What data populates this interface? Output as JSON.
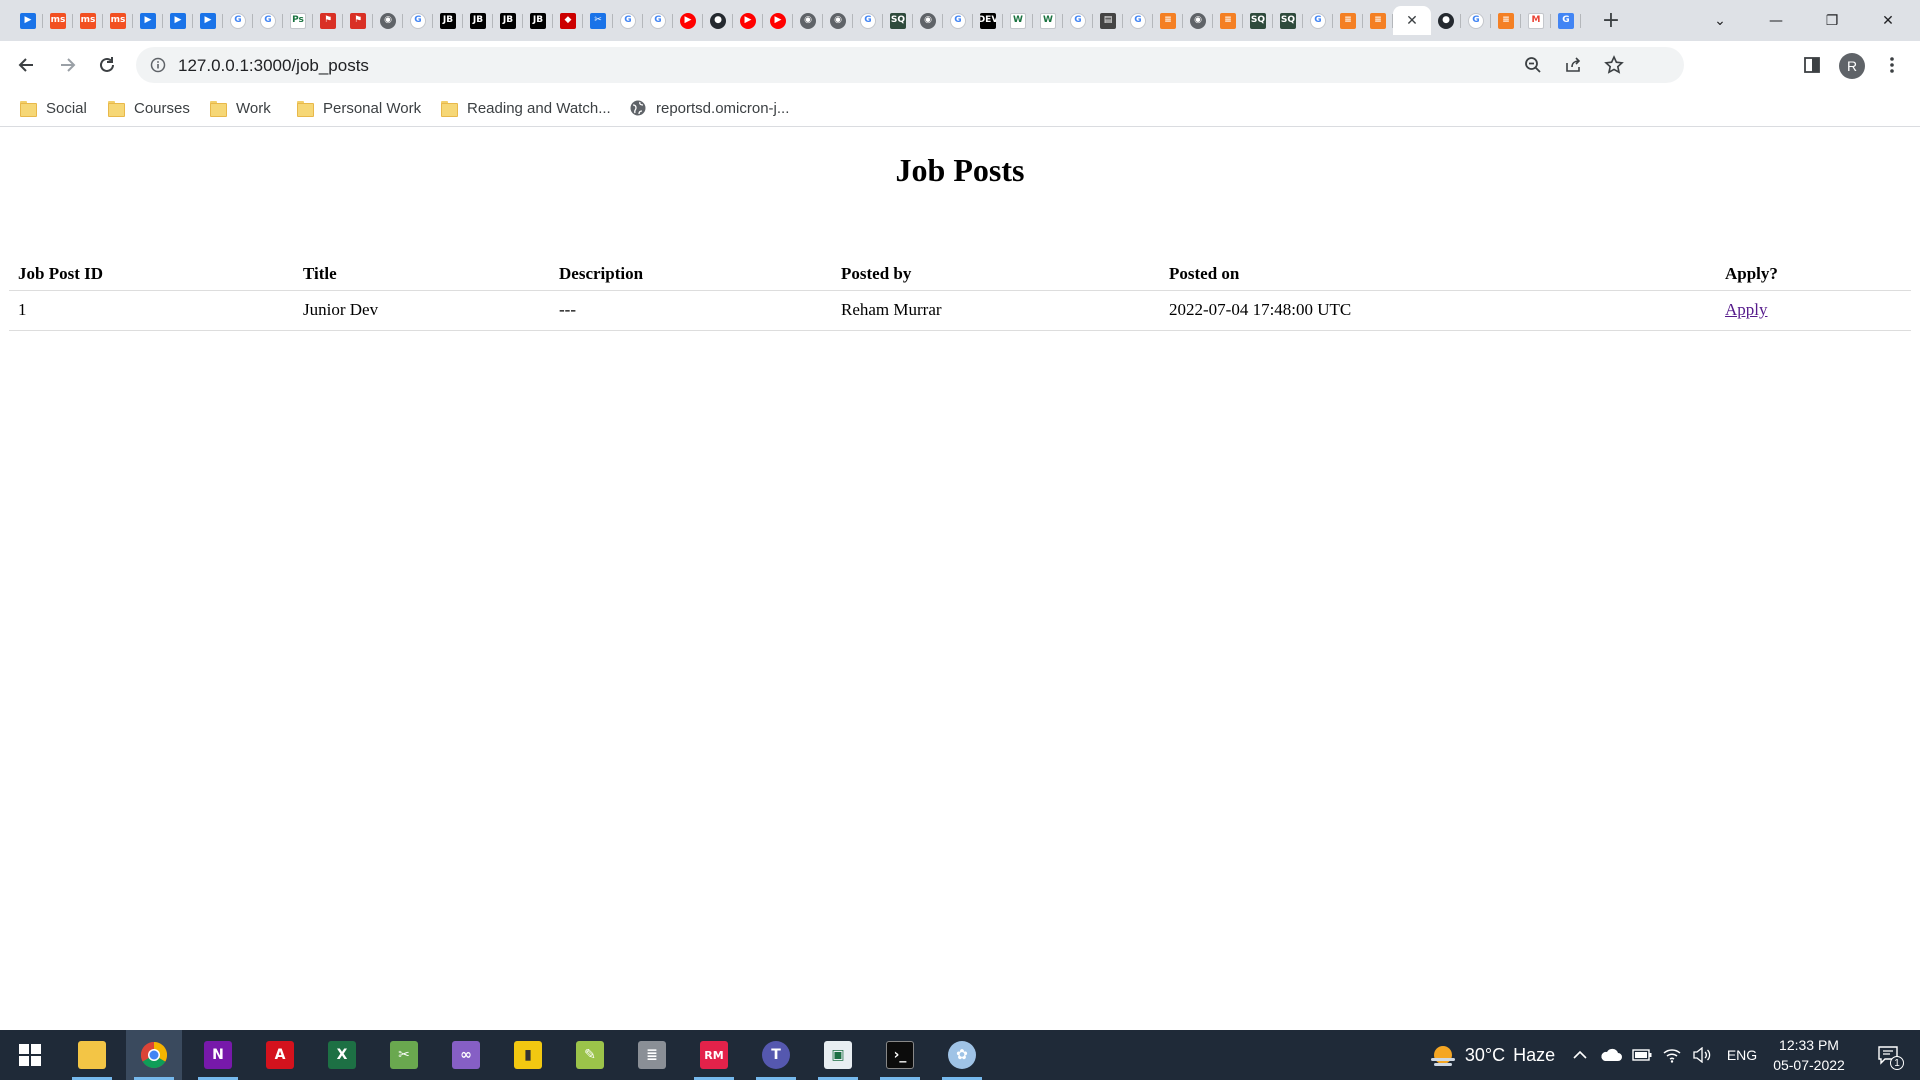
{
  "browser": {
    "tabs": [
      {
        "icon": "remote-desktop-icon",
        "color": "#1a73e8",
        "glyph": "▶"
      },
      {
        "icon": "microsoft-icon",
        "color": "#f25022",
        "glyph": "ms"
      },
      {
        "icon": "microsoft-icon",
        "color": "#f25022",
        "glyph": "ms"
      },
      {
        "icon": "microsoft-icon",
        "color": "#f25022",
        "glyph": "ms"
      },
      {
        "icon": "remote-desktop-icon",
        "color": "#1a73e8",
        "glyph": "▶"
      },
      {
        "icon": "remote-desktop-icon",
        "color": "#1a73e8",
        "glyph": "▶"
      },
      {
        "icon": "remote-desktop-icon",
        "color": "#1a73e8",
        "glyph": "▶"
      },
      {
        "icon": "google-icon",
        "color": "#ffffff",
        "glyph": "G"
      },
      {
        "icon": "google-icon",
        "color": "#ffffff",
        "glyph": "G"
      },
      {
        "icon": "ps-icon",
        "color": "#ffffff",
        "glyph": "Ps"
      },
      {
        "icon": "flag-icon",
        "color": "#d93025",
        "glyph": "⚑"
      },
      {
        "icon": "flag-icon",
        "color": "#d93025",
        "glyph": "⚑"
      },
      {
        "icon": "globe-icon",
        "color": "#5f6368",
        "glyph": "◉"
      },
      {
        "icon": "google-icon",
        "color": "#ffffff",
        "glyph": "G"
      },
      {
        "icon": "jetbrains-icon",
        "color": "#000000",
        "glyph": "JB"
      },
      {
        "icon": "jetbrains-icon",
        "color": "#000000",
        "glyph": "JB"
      },
      {
        "icon": "jetbrains-icon",
        "color": "#000000",
        "glyph": "JB"
      },
      {
        "icon": "jetbrains-icon",
        "color": "#000000",
        "glyph": "JB"
      },
      {
        "icon": "ruby-icon",
        "color": "#cc0000",
        "glyph": "◆"
      },
      {
        "icon": "tools-icon",
        "color": "#1a73e8",
        "glyph": "✂"
      },
      {
        "icon": "google-icon",
        "color": "#ffffff",
        "glyph": "G"
      },
      {
        "icon": "google-icon",
        "color": "#ffffff",
        "glyph": "G"
      },
      {
        "icon": "youtube-icon",
        "color": "#ff0000",
        "glyph": "▶"
      },
      {
        "icon": "github-icon",
        "color": "#24292f",
        "glyph": "●"
      },
      {
        "icon": "youtube-icon",
        "color": "#ff0000",
        "glyph": "▶"
      },
      {
        "icon": "youtube-icon",
        "color": "#ff0000",
        "glyph": "▶"
      },
      {
        "icon": "globe-icon",
        "color": "#5f6368",
        "glyph": "◉"
      },
      {
        "icon": "globe-icon",
        "color": "#5f6368",
        "glyph": "◉"
      },
      {
        "icon": "google-icon",
        "color": "#ffffff",
        "glyph": "G"
      },
      {
        "icon": "sql-icon",
        "color": "#2e4a3c",
        "glyph": "SQ"
      },
      {
        "icon": "globe-icon",
        "color": "#5f6368",
        "glyph": "◉"
      },
      {
        "icon": "google-icon",
        "color": "#ffffff",
        "glyph": "G"
      },
      {
        "icon": "dev-icon",
        "color": "#000000",
        "glyph": "DEV"
      },
      {
        "icon": "w-icon",
        "color": "#ffffff",
        "glyph": "W"
      },
      {
        "icon": "w-icon",
        "color": "#ffffff",
        "glyph": "W"
      },
      {
        "icon": "google-icon",
        "color": "#ffffff",
        "glyph": "G"
      },
      {
        "icon": "docs-icon",
        "color": "#444444",
        "glyph": "▤"
      },
      {
        "icon": "google-icon",
        "color": "#ffffff",
        "glyph": "G"
      },
      {
        "icon": "stackoverflow-icon",
        "color": "#f48024",
        "glyph": "≡"
      },
      {
        "icon": "globe-icon",
        "color": "#5f6368",
        "glyph": "◉"
      },
      {
        "icon": "stackoverflow-icon",
        "color": "#f48024",
        "glyph": "≡"
      },
      {
        "icon": "sql-icon",
        "color": "#2e4a3c",
        "glyph": "SQ"
      },
      {
        "icon": "sql-icon",
        "color": "#2e4a3c",
        "glyph": "SQ"
      },
      {
        "icon": "google-icon",
        "color": "#ffffff",
        "glyph": "G"
      },
      {
        "icon": "stackoverflow-icon",
        "color": "#f48024",
        "glyph": "≡"
      },
      {
        "icon": "stackoverflow-icon",
        "color": "#f48024",
        "glyph": "≡"
      }
    ],
    "active_tab": {
      "icon": "close-icon",
      "glyph": "✕"
    },
    "tabs_after": [
      {
        "icon": "github-icon",
        "color": "#24292f",
        "glyph": "●"
      },
      {
        "icon": "google-icon",
        "color": "#ffffff",
        "glyph": "G"
      },
      {
        "icon": "stackoverflow-icon",
        "color": "#f48024",
        "glyph": "≡"
      },
      {
        "icon": "gmail-icon",
        "color": "#ffffff",
        "glyph": "M"
      },
      {
        "icon": "translate-icon",
        "color": "#4285f4",
        "glyph": "G"
      }
    ],
    "new_tab_glyph": "+",
    "url": "127.0.0.1:3000/job_posts",
    "profile_initial": "R",
    "bookmarks": [
      {
        "label": "Social",
        "type": "folder"
      },
      {
        "label": "Courses",
        "type": "folder"
      },
      {
        "label": "Work",
        "type": "folder"
      },
      {
        "label": "Personal Work",
        "type": "folder"
      },
      {
        "label": "Reading and Watch...",
        "type": "folder"
      },
      {
        "label": "reportsd.omicron-j...",
        "type": "site"
      }
    ]
  },
  "page": {
    "title": "Job Posts",
    "table": {
      "headers": {
        "id": "Job Post ID",
        "title": "Title",
        "description": "Description",
        "posted_by": "Posted by",
        "posted_on": "Posted on",
        "apply": "Apply?"
      },
      "rows": [
        {
          "id": "1",
          "title": "Junior Dev",
          "description": "---",
          "posted_by": "Reham Murrar",
          "posted_on": "2022-07-04 17:48:00 UTC",
          "apply_link": "Apply"
        }
      ]
    }
  },
  "taskbar": {
    "weather_temp": "30°C",
    "weather_desc": "Haze",
    "language": "ENG",
    "time": "12:33 PM",
    "date": "05-07-2022",
    "notification_count": "1"
  }
}
